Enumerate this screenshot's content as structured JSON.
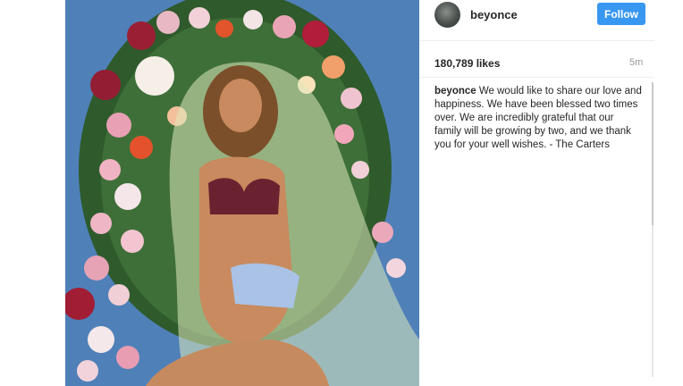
{
  "post": {
    "image_alt": "pregnant woman kneeling under veil in front of floral arch",
    "username": "beyonce",
    "follow_label": "Follow",
    "likes": "180,789 likes",
    "time": "5m",
    "caption_user": "beyonce",
    "caption_text": "We would like to share our love and happiness. We have been blessed two times over. We are incredibly grateful that our family will be growing by two, and we thank you for your well wishes. - The Carters"
  },
  "colors": {
    "follow_button": "#3897f0",
    "sky": "#4f7fb5",
    "veil": "#d7e6b4"
  },
  "icons": {
    "avatar": "avatar-icon"
  }
}
